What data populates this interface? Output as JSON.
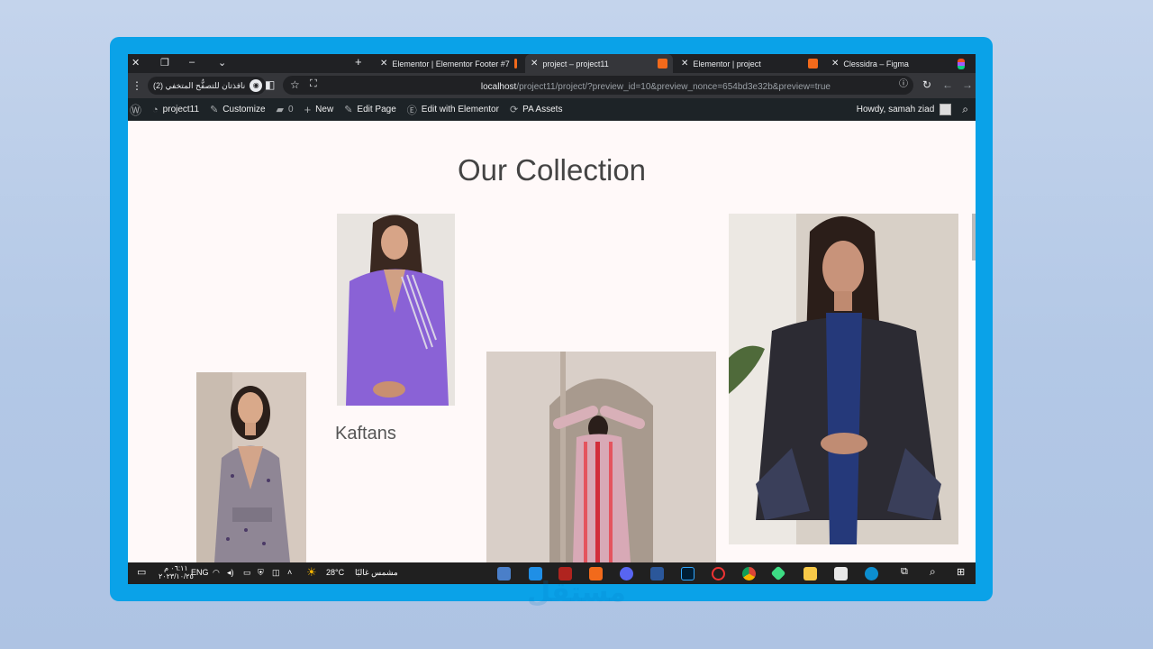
{
  "browser": {
    "tabs": [
      {
        "label": "Elementor | Elementor Footer #7"
      },
      {
        "label": "project – project11"
      },
      {
        "label": "Elementor | project"
      },
      {
        "label": "Clessidra – Figma"
      }
    ],
    "profile_label": "نافذتان للتصفُّح المتخفي (2)",
    "url_host": "localhost",
    "url_path": "/project11/project/?preview_id=10&preview_nonce=654bd3e32b&preview=true"
  },
  "wp_admin_bar": {
    "site": "project11",
    "customize": "Customize",
    "comments": "0",
    "new": "New",
    "edit_page": "Edit Page",
    "edit_elementor": "Edit with Elementor",
    "pa_assets": "PA Assets",
    "howdy": "Howdy, samah ziad"
  },
  "page": {
    "heading": "Our Collection",
    "kaftans_label": "Kaftans"
  },
  "taskbar": {
    "weather_temp": "28°C",
    "weather_text": "مشمس غالبًا",
    "lang": "ENG",
    "time": "٠٦:١١ م",
    "date": "٢٠٢٣/١٠/٢٥"
  },
  "watermark": "مستقل",
  "colors": {
    "frame": "#0aa2e8",
    "admin_bar": "#1d2327",
    "page_bg": "#fff9f9"
  }
}
